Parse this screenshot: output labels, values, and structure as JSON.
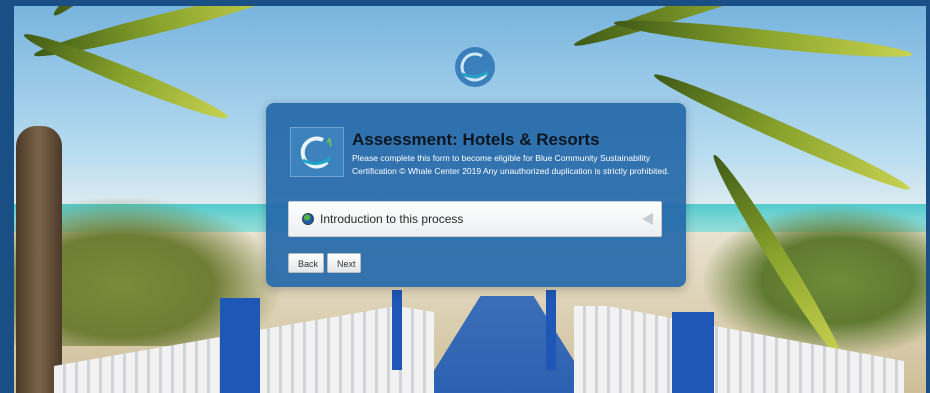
{
  "assessment": {
    "title": "Assessment: Hotels & Resorts",
    "description": "Please complete this form to become eligible for Blue Community Sustainability Certification © Whale Center 2019 Any unauthorized duplication is strictly prohibited."
  },
  "sections": [
    {
      "label": "Introduction to this process",
      "icon": "globe-icon",
      "expander": "triangle-left-icon"
    }
  ],
  "nav": {
    "back_label": "Back",
    "next_label": "Next"
  },
  "icons": {
    "brand": "whale-center-logo"
  },
  "colors": {
    "card_bg": "#2669aa",
    "page_border": "#1a4f86"
  }
}
